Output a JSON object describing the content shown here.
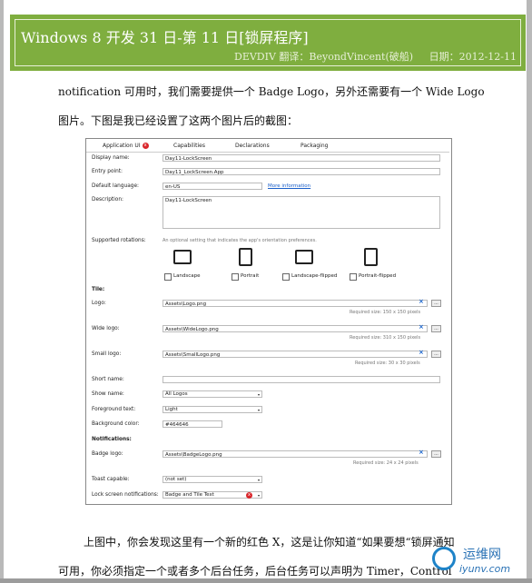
{
  "header": {
    "title": "Windows 8  开发 31 日-第 11 日[锁屏程序]",
    "meta_source": "DEVDIV 翻译：BeyondVincent(破船)",
    "meta_date": "日期：2012-12-11"
  },
  "body": {
    "para1_line1": "notification 可用时，我们需要提供一个 Badge Logo，另外还需要有一个 Wide Logo",
    "para1_line2": "图片。下图是我已经设置了这两个图片后的截图：",
    "para2_line1": "上图中，你会发现这里有一个新的红色 X，这是让你知道“如果要想“锁屏通知",
    "para2_line2": "可用，你必须指定一个或者多个后台任务，后台任务可以声明为 Timer，Control"
  },
  "screenshot": {
    "tabs": [
      "Application UI",
      "Capabilities",
      "Declarations",
      "Packaging"
    ],
    "error_glyph": "x",
    "display_name_label": "Display name:",
    "display_name_value": "Day11-LockScreen",
    "entry_point_label": "Entry point:",
    "entry_point_value": "Day11_LockScreen.App",
    "default_language_label": "Default language:",
    "default_language_value": "en-US",
    "more_information": "More information",
    "description_label": "Description:",
    "description_value": "Day11-LockScreen",
    "supported_rotations_label": "Supported rotations:",
    "supported_rotations_hint": "An optional setting that indicates the app's orientation preferences.",
    "rotations": [
      "Landscape",
      "Portrait",
      "Landscape-flipped",
      "Portrait-flipped"
    ],
    "tile_heading": "Tile:",
    "logo_label": "Logo:",
    "logo_value": "Assets\\Logo.png",
    "logo_hint": "Required size: 150 x 150 pixels",
    "wide_logo_label": "Wide logo:",
    "wide_logo_value": "Assets\\WideLogo.png",
    "wide_logo_hint": "Required size: 310 x 150 pixels",
    "small_logo_label": "Small logo:",
    "small_logo_value": "Assets\\SmallLogo.png",
    "small_logo_hint": "Required size: 30 x 30 pixels",
    "short_name_label": "Short name:",
    "show_name_label": "Show name:",
    "show_name_value": "All Logos",
    "foreground_text_label": "Foreground text:",
    "foreground_text_value": "Light",
    "background_color_label": "Background color:",
    "background_color_value": "#464646",
    "notifications_heading": "Notifications:",
    "badge_logo_label": "Badge logo:",
    "badge_logo_value": "Assets\\BadgeLogo.png",
    "badge_logo_hint": "Required size: 24 x 24 pixels",
    "toast_capable_label": "Toast capable:",
    "toast_capable_value": "(not set)",
    "lock_screen_label": "Lock screen notifications:",
    "lock_screen_value": "Badge and Tile Text",
    "clear_glyph": "×",
    "browse_glyph": "...",
    "dropdown_glyph": "▾"
  },
  "watermark": {
    "name": "运维网",
    "url": "iyunv.com"
  },
  "colors": {
    "banner": "#7fae3f",
    "error": "#d9262b",
    "link": "#1a5fc9"
  }
}
